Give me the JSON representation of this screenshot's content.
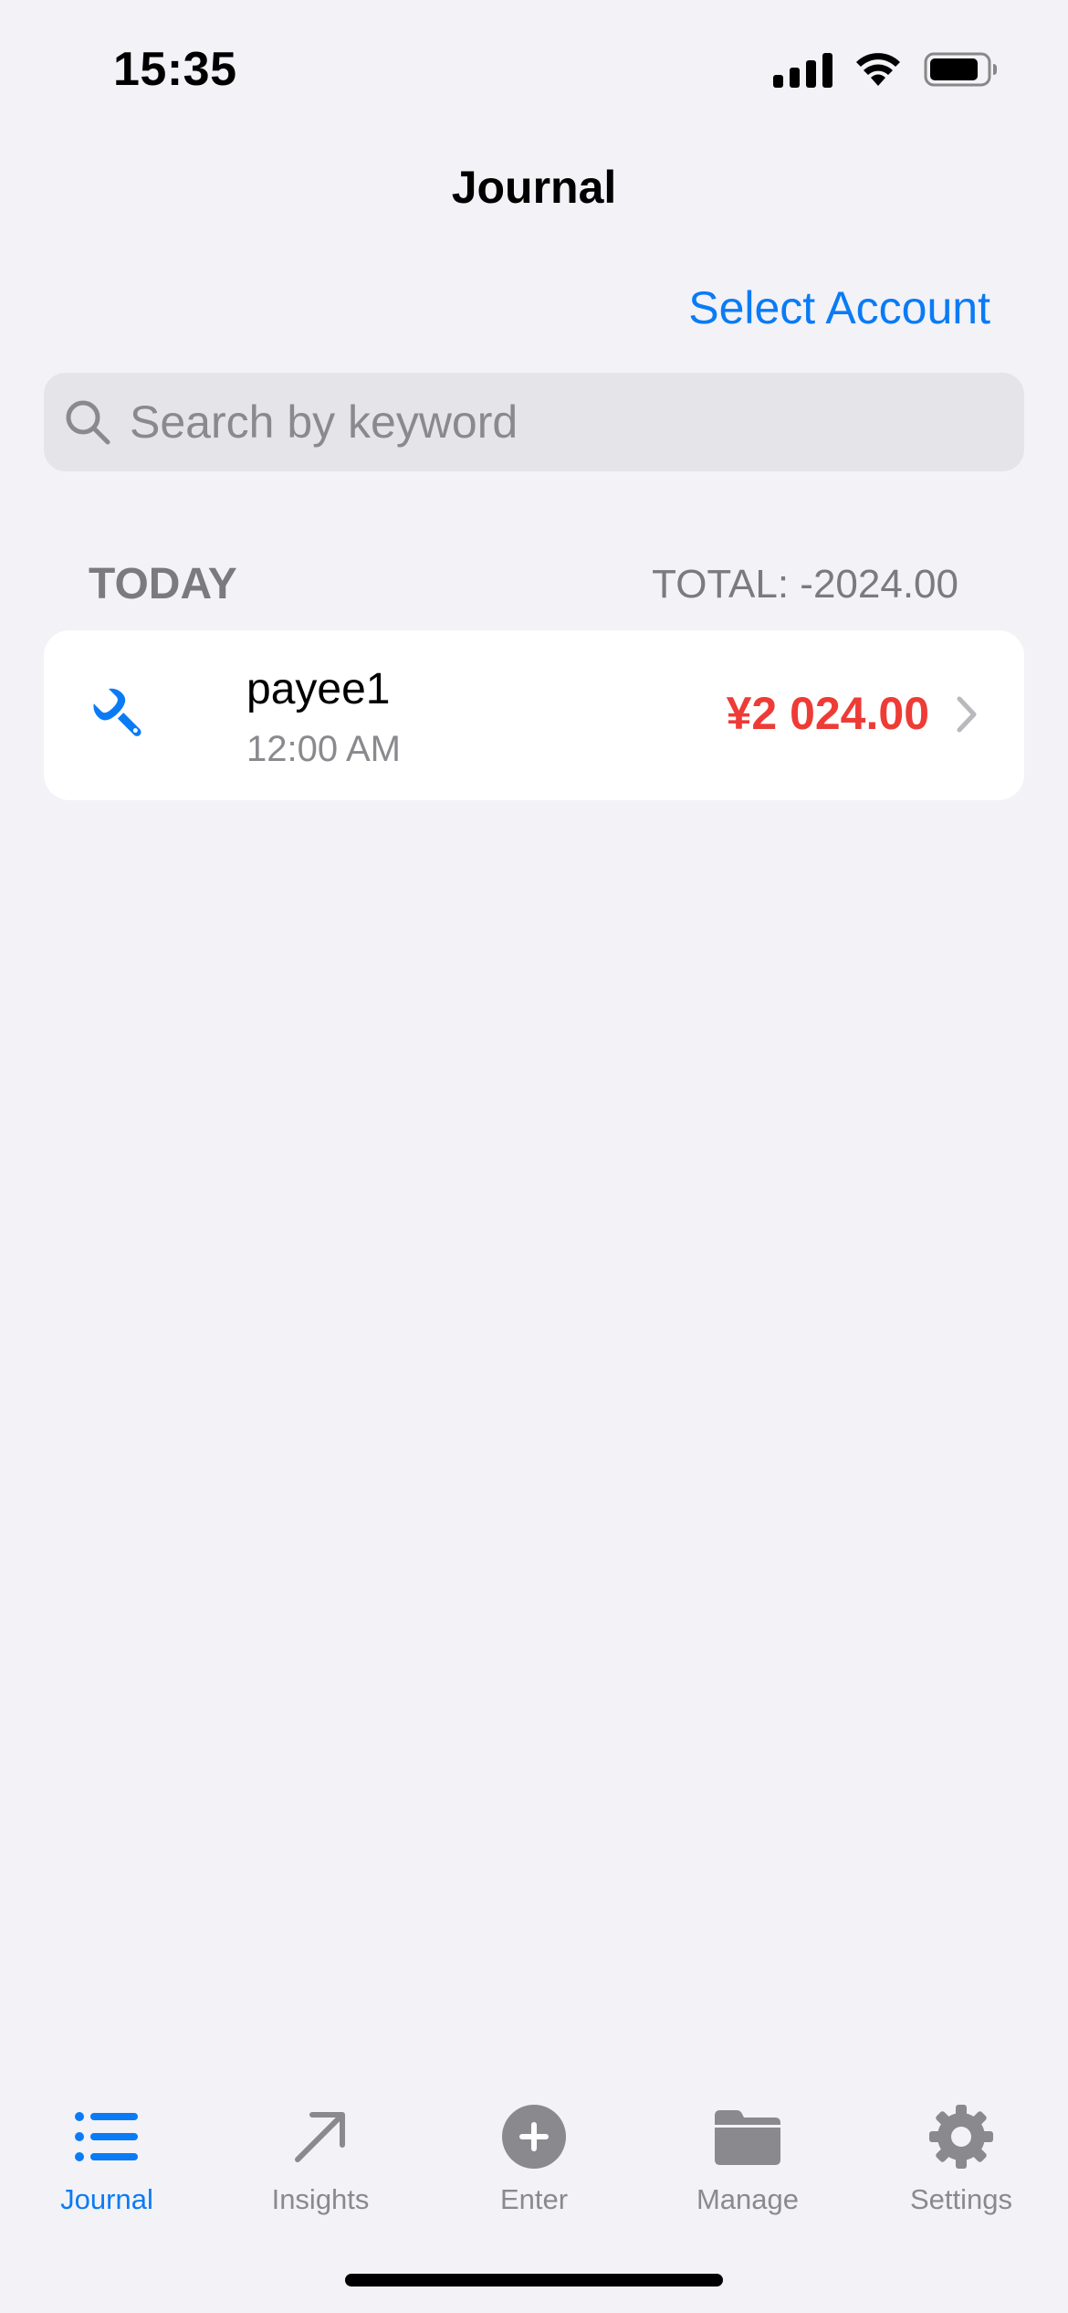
{
  "status_bar": {
    "time": "15:35",
    "icons": [
      "signal-icon",
      "wifi-icon",
      "battery-icon"
    ]
  },
  "nav": {
    "title": "Journal",
    "select_account_label": "Select Account"
  },
  "search": {
    "placeholder": "Search by keyword",
    "value": ""
  },
  "section": {
    "title": "TODAY",
    "total": "TOTAL: -2024.00"
  },
  "transactions": [
    {
      "icon": "wrench-icon",
      "payee": "payee1",
      "time": "12:00 AM",
      "amount": "¥2 024.00"
    }
  ],
  "tab_bar": {
    "items": [
      {
        "label": "Journal",
        "icon": "list-icon",
        "active": true
      },
      {
        "label": "Insights",
        "icon": "arrow-up-right-icon",
        "active": false
      },
      {
        "label": "Enter",
        "icon": "plus-circle-icon",
        "active": false
      },
      {
        "label": "Manage",
        "icon": "folder-icon",
        "active": false
      },
      {
        "label": "Settings",
        "icon": "gear-icon",
        "active": false
      }
    ]
  },
  "colors": {
    "accent": "#0a7bf5",
    "amount_negative": "#ee3b36",
    "background": "#f2f2f7",
    "secondary_text": "#8a8a8e"
  }
}
